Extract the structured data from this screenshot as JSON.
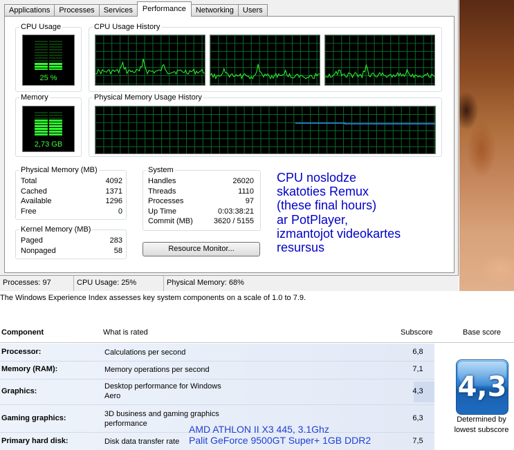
{
  "tabs": [
    "Applications",
    "Processes",
    "Services",
    "Performance",
    "Networking",
    "Users"
  ],
  "active_tab": "Performance",
  "cpu_usage": {
    "title": "CPU Usage",
    "value_label": "25 %",
    "fraction": 0.25
  },
  "cpu_history": {
    "title": "CPU Usage History"
  },
  "memory": {
    "title": "Memory",
    "value_label": "2,73 GB",
    "fraction": 0.68
  },
  "physical_memory_history": {
    "title": "Physical Memory Usage History"
  },
  "physical_memory": {
    "title": "Physical Memory (MB)",
    "rows": [
      {
        "label": "Total",
        "value": "4092"
      },
      {
        "label": "Cached",
        "value": "1371"
      },
      {
        "label": "Available",
        "value": "1296"
      },
      {
        "label": "Free",
        "value": "0"
      }
    ]
  },
  "kernel_memory": {
    "title": "Kernel Memory (MB)",
    "rows": [
      {
        "label": "Paged",
        "value": "283"
      },
      {
        "label": "Nonpaged",
        "value": "58"
      }
    ]
  },
  "system": {
    "title": "System",
    "rows": [
      {
        "label": "Handles",
        "value": "26020"
      },
      {
        "label": "Threads",
        "value": "1110"
      },
      {
        "label": "Processes",
        "value": "97"
      },
      {
        "label": "Up Time",
        "value": "0:03:38:21"
      },
      {
        "label": "Commit (MB)",
        "value": "3620 / 5155"
      }
    ]
  },
  "resource_monitor_label": "Resource Monitor...",
  "annotation": {
    "lines": [
      "CPU noslodze",
      "skatoties Remux",
      "(these final hours)",
      "ar PotPlayer,",
      "izmantojot videokartes",
      "resursus"
    ],
    "color": "#0000c8"
  },
  "status_bar": {
    "processes": "Processes: 97",
    "cpu": "CPU Usage: 25%",
    "memory": "Physical Memory: 68%"
  },
  "wei": {
    "intro": "The Windows Experience Index assesses key system components on a scale of 1.0 to 7.9.",
    "headers": {
      "component": "Component",
      "rated": "What is rated",
      "subscore": "Subscore",
      "base": "Base score"
    },
    "rows": [
      {
        "component": "Processor:",
        "rated": "Calculations per second",
        "subscore": "6,8"
      },
      {
        "component": "Memory (RAM):",
        "rated": "Memory operations per second",
        "subscore": "7,1"
      },
      {
        "component": "Graphics:",
        "rated_line1": "Desktop performance for Windows",
        "rated_line2": "Aero",
        "subscore": "4,3"
      },
      {
        "component": "Gaming graphics:",
        "rated_line1": "3D business and gaming graphics",
        "rated_line2": "performance",
        "subscore": "6,3"
      },
      {
        "component": "Primary hard disk:",
        "rated": "Disk data transfer rate",
        "subscore": "7,5"
      }
    ],
    "base_score": "4,3",
    "base_note_line1": "Determined by",
    "base_note_line2": "lowest subscore",
    "hardware_note": [
      "AMD ATHLON II X3 445, 3.1Ghz",
      "Palit GeForce 9500GT Super+ 1GB  DDR2"
    ],
    "hardware_note_color": "#1f3fd0"
  },
  "colors": {
    "graph_green": "#2fff2f",
    "memory_line": "#2f8fff",
    "grid": "#0a6b2a"
  }
}
